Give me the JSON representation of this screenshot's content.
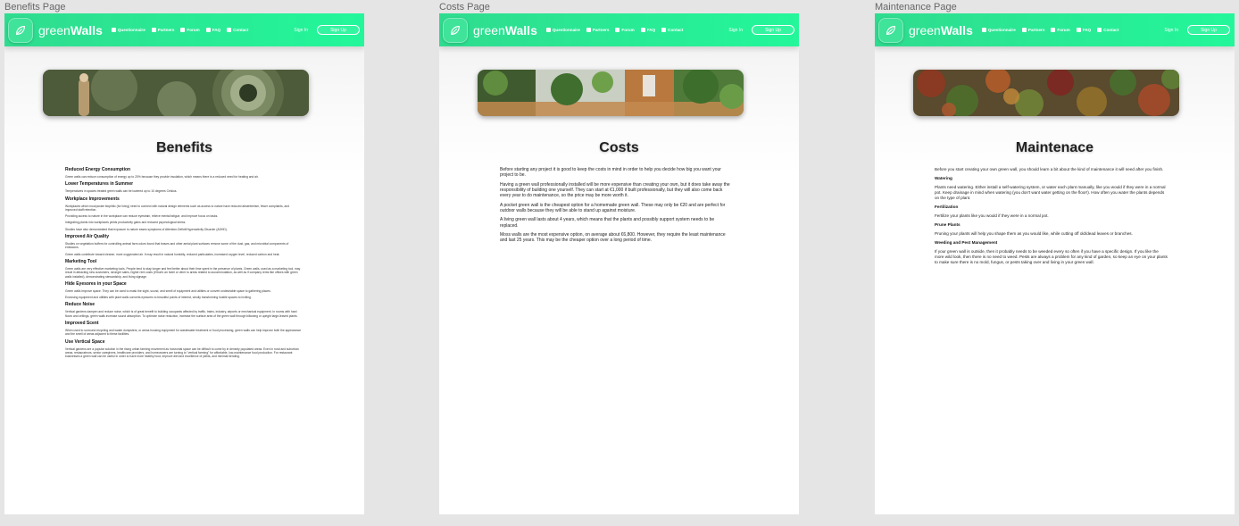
{
  "colors": {
    "nav_start": "#2fdc8f",
    "nav_end": "#23f79a",
    "canvas": "#e5e5e5",
    "page": "#ffffff"
  },
  "nav": {
    "brand_light": "green",
    "brand_bold": "Walls",
    "logo_icon": "leaf-icon",
    "items": [
      {
        "label": "Questionnaire",
        "icon": "questionnaire-icon"
      },
      {
        "label": "Partners",
        "icon": "partners-icon"
      },
      {
        "label": "Forum",
        "icon": "forum-icon"
      },
      {
        "label": "FAQ",
        "icon": "faq-icon"
      },
      {
        "label": "Contact",
        "icon": "contact-icon"
      }
    ],
    "signin": "Sign In",
    "signup": "Sign Up"
  },
  "frames": {
    "benefits": {
      "label": "Benefits Page",
      "title": "Benefits",
      "sections": [
        {
          "heading": "Reduced Energy Consumption",
          "paras": [
            "Green walls can reduce consumption of energy up to 20% because they provide insulation, which means there is a reduced need for heating and air."
          ]
        },
        {
          "heading": "Lower Temperatures in Summer",
          "paras": [
            "Temperatures in spaces treated green walls can be lowered up to 10 degrees Celsius."
          ]
        },
        {
          "heading": "Workplace Improvements",
          "paras": [
            "Workplaces which incorporate biophilic (for living) need to connect with natural design elements such as access to nature have reduced absenteeism, fewer complaints, and improved staff retention.",
            "Providing access to nature in the workplace can reduce eyestrain, relieve mental fatigue, and improve focus on tasks.",
            "Integrating plants into workplaces yields productivity gains and reduced psychological stress.",
            "Studies have also demonstrated that exposure to nature eases symptoms of Attention-Deficit/Hyperactivity Disorder (ADHD)."
          ]
        },
        {
          "heading": "Improved Air Quality",
          "paras": [
            "Studies on vegetation buffers for controlling animal farm odors found that leaves and other aerial plant surfaces remove some of the dust, gas, and microbial components of emissions.",
            "Green walls contribute toward cleaner, more oxygenated air. It may result in natural humidity, reduced particulates, increased oxygen level, reduced carbon and heat."
          ]
        },
        {
          "heading": "Marketing Tool",
          "paras": [
            "Green walls are very effective marketing tools. People tend to stay longer and feel better about their time spent in the presence of plants. Green walls, used as a marketing tool, may result in attracting new customers, stronger sales, higher rent costs (if that's an hotel or other to areas related to accommodation, as well as if company rents like offices with green walls installed), demonstrating stewardship, and living signage."
          ]
        },
        {
          "heading": "Hide Eyesores in your Space",
          "paras": [
            "Green walls improve space. They can be used to mask the sight, sound, and smell of equipment and utilities or convert undesirable space to gathering places.",
            "Enclosing equipment and utilities with plant walls converts eyesores to beautiful points of interest, wholly transforming hostile spaces to inviting."
          ]
        },
        {
          "heading": "Reduce Noise",
          "paras": [
            "Vertical gardens dampen and reduce noise, which is of great benefit to building occupants affected by traffic, trains, industry, airports or mechanical equipment. In rooms with hard floors and ceilings, green walls increase sound absorption. To optimize noise reduction, increase the surface area of the green wall through billowing or upright large-leaved plants."
          ]
        },
        {
          "heading": "Improved Scent",
          "paras": [
            "When used to surround recycling and waste dumpsters, or areas housing equipment for wastewater treatment or food processing, green walls can help improve both the appearance and the smell of areas adjacent to these facilities."
          ]
        },
        {
          "heading": "Use Vertical Space",
          "paras": [
            "Vertical gardens are a popular solution in the rising urban farming movement as horizontal space can be difficult to come by in densely populated areas. Even in rural and suburban areas, restaurateurs, senior caregivers, healthcare providers, and homeowners are turning to \"vertical farming\" for affordable, low-maintenance food production. For restaurant businesses a green wall can be useful in order to have more healthy food, improve diet and excellence of yields, and minimal bending."
          ]
        }
      ]
    },
    "costs": {
      "label": "Costs Page",
      "title": "Costs",
      "paras": [
        "Before starting any project it is good to keep the costs in mind in order to help you decide how big you want your project to be.",
        "Having a green wall professionally installed will be more expensive than creating your own, but it does take away the responsibility of building one yourself. They can start at €1,000 if built professionally, but they will also come back every year to do maintenance, so the price may be more worth it.",
        "A pocket green wall is the cheapest option for a homemade green wall. These may only be €20 and are perfect for outdoor walls because they will be able to stand up against moisture.",
        "A living green wall lasts about 4 years, which means that the plants and possibly support system needs to be replaced.",
        "Moss walls are the most expensive option, on average about €6,800. However, they require the least maintenance and last 25 years. This may be the cheaper option over a long period of time."
      ]
    },
    "maintenance": {
      "label": "Maintenance Page",
      "title": "Maintenace",
      "intro": "Before you start creating your own green wall, you should learn a bit about the kind of maintenance it will need after you finish.",
      "sections": [
        {
          "heading": "Watering",
          "text": "Plants need watering. Either install a self-watering system, or water each plant manually, like you would if they were in a normal pot. Keep drainage in mind when watering (you don't want water getting on the floor!). How often you water the plants depends on the type of plant."
        },
        {
          "heading": "Fertilization",
          "text": "Fertilize your plants like you would if they were in a normal pot."
        },
        {
          "heading": "Prune Plants",
          "text": "Pruning your plants will help you shape them as you would like, while cutting off old/dead leaves or branches."
        },
        {
          "heading": "Weeding and Pest Management",
          "text": "If your green wall is outside, then it probably needs to be weeded every so often if you have a specific design. If you like the more wild look, then there is no need to weed. Pests are always a problem for any kind of garden, so keep an eye on your plants to make sure there is no mold, fungus, or pests taking over and living in your green wall."
        }
      ]
    }
  }
}
